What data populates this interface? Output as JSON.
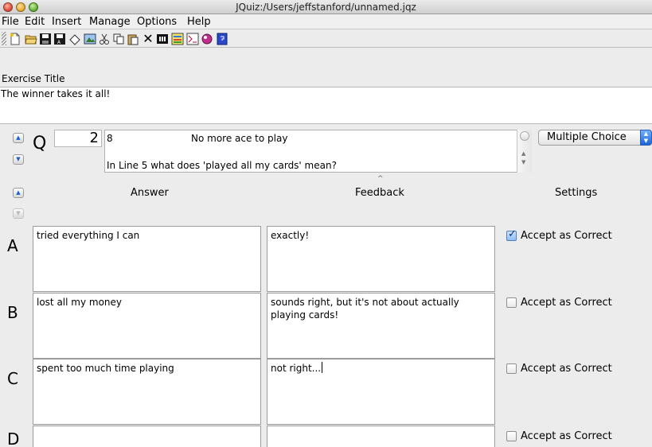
{
  "window": {
    "title": "JQuiz:/Users/jeffstanford/unnamed.jqz"
  },
  "menu": [
    "File",
    "Edit",
    "Insert",
    "Manage",
    "Options",
    "Help"
  ],
  "toolbar": {
    "icons": [
      "new-file-icon",
      "open-folder-icon",
      "save-icon",
      "save-as-icon",
      "eraser-icon",
      "web-export-icon",
      "cut-icon",
      "copy-icon",
      "paste-icon",
      "delete-icon",
      "text-icon",
      "web-page-icon",
      "html-icon",
      "hot-potatoes-icon",
      "help-icon"
    ]
  },
  "exercise": {
    "label": "Exercise Title",
    "title": "The winner takes it all!"
  },
  "question": {
    "letter": "Q",
    "number": "2",
    "line_number": "8",
    "line_text": "No more ace to play",
    "prompt": "In Line 5 what does 'played all my cards' mean?",
    "type": "Multiple Choice"
  },
  "headers": {
    "answer": "Answer",
    "feedback": "Feedback",
    "settings": "Settings"
  },
  "answers": [
    {
      "letter": "A",
      "answer": "tried everything I can",
      "feedback": "exactly!",
      "correct": true,
      "setting_label": "Accept as Correct"
    },
    {
      "letter": "B",
      "answer": "lost all my money",
      "feedback": "sounds right, but it's not about actually playing cards!",
      "correct": false,
      "setting_label": "Accept as Correct"
    },
    {
      "letter": "C",
      "answer": "spent too much time playing",
      "feedback": "not right...",
      "correct": false,
      "setting_label": "Accept as Correct"
    },
    {
      "letter": "D",
      "answer": "",
      "feedback": "",
      "correct": false,
      "setting_label": "Accept as Correct"
    }
  ],
  "colors": {
    "accent": "#1b66d6",
    "window_bg": "#ececec"
  }
}
